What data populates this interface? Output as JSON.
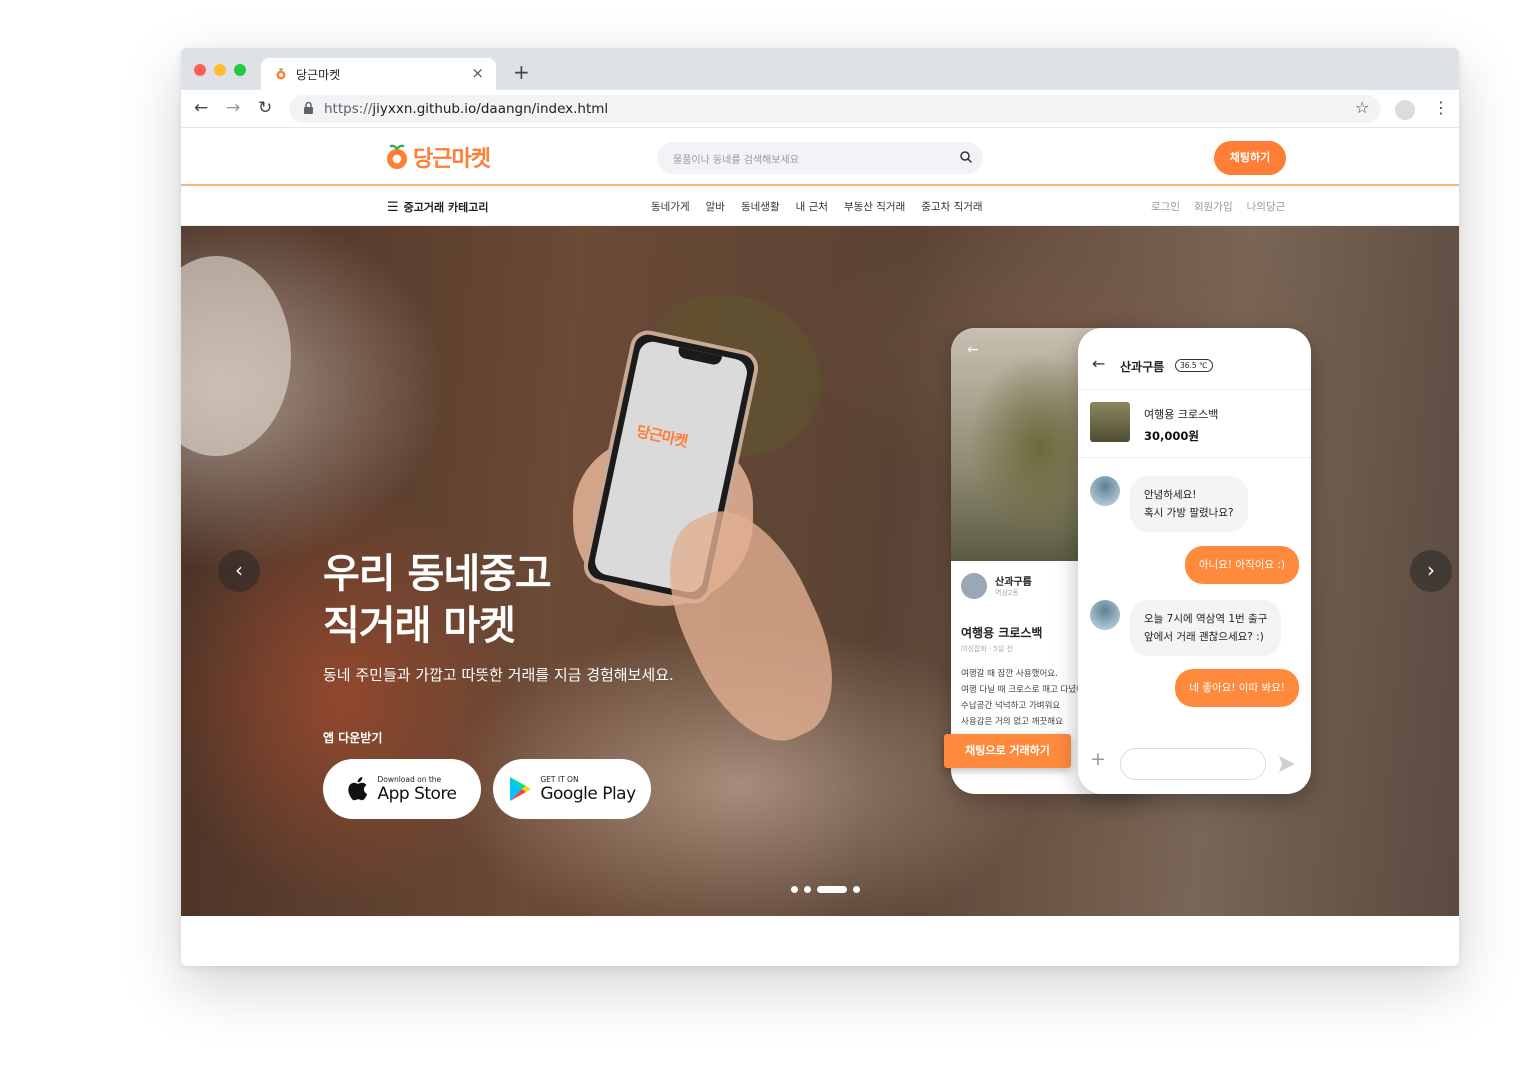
{
  "browser": {
    "tab_title": "당근마켓",
    "url_scheme": "https://",
    "url_rest": "jiyxxn.github.io/daangn/index.html"
  },
  "header": {
    "logo_text": "당근마켓",
    "search_placeholder": "물품이나 동네를 검색해보세요",
    "chat_button": "채팅하기"
  },
  "gnb": {
    "category": "중고거래 카테고리",
    "menu": [
      "동네가게",
      "알바",
      "동네생활",
      "내 근처",
      "부동산 직거래",
      "중고차 직거래"
    ],
    "right": [
      "로그인",
      "회원가입",
      "나의당근"
    ]
  },
  "hero": {
    "title_line1": "우리 동네중고",
    "title_line2": "직거래 마켓",
    "subtitle": "동네 주민들과 가깝고 따뜻한 거래를 지금 경험해보세요.",
    "download_label": "앱 다운받기",
    "appstore_small": "Download on the",
    "appstore_big": "App Store",
    "googleplay_small": "GET IT ON",
    "googleplay_big": "Google Play",
    "phone_logo": "당근마켓",
    "pagination_active_index": 2,
    "pagination_count": 4
  },
  "product_card": {
    "seller_name": "산과구름",
    "seller_location": "역삼2동",
    "item_title": "여행용 크로스백",
    "item_meta": "여성잡화 · 5일 전",
    "desc_lines": [
      "여행갈 때 잠깐 사용했어요.",
      "여행 다닐 때 크로스로 매고 다녔어요",
      "수납공간 넉넉하고 가벼워요",
      "사용감은 거의 없고 깨끗해요"
    ],
    "trade_button": "채팅으로 거래하기"
  },
  "chat_card": {
    "user_name": "산과구름",
    "temperature": "36.5 ℃",
    "item_name": "여행용 크로스백",
    "item_price": "30,000원",
    "messages": [
      {
        "from": "other",
        "line1": "안녕하세요!",
        "line2": "혹시 가방 팔렸나요?"
      },
      {
        "from": "me",
        "text": "아니요! 아직이요 :)"
      },
      {
        "from": "other",
        "line1": "오늘 7시에 역삼역 1번 출구",
        "line2": "앞에서 거래 괜찮으세요? :)"
      },
      {
        "from": "me",
        "text": "네 좋아요! 이따 봐요!"
      }
    ]
  },
  "colors": {
    "brand": "#ff7e36"
  }
}
